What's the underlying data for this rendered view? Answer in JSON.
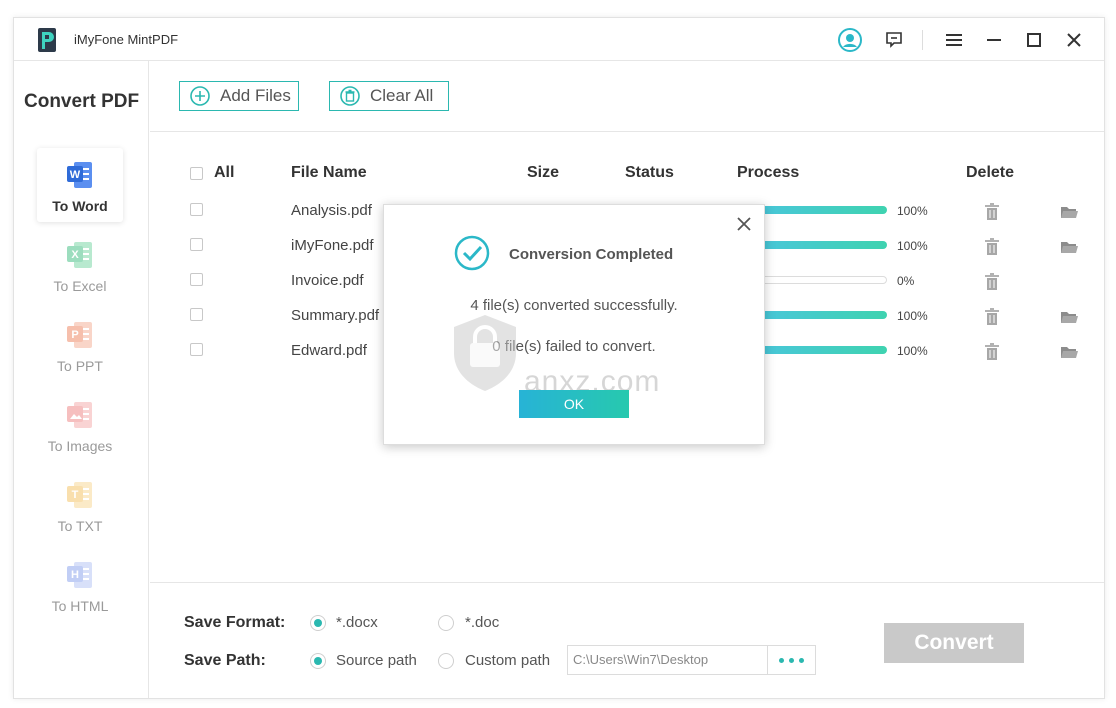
{
  "app": {
    "title": "iMyFone MintPDF"
  },
  "sidebar": {
    "title": "Convert PDF",
    "items": [
      {
        "label": "To Word",
        "letter": "W",
        "color": "#2f6bd8",
        "active": true
      },
      {
        "label": "To Excel",
        "letter": "X",
        "color": "#4cc38a",
        "active": false
      },
      {
        "label": "To PPT",
        "letter": "P",
        "color": "#ef8b6a",
        "active": false
      },
      {
        "label": "To Images",
        "letter": "img",
        "color": "#ef8b8b",
        "active": false
      },
      {
        "label": "To TXT",
        "letter": "T",
        "color": "#f5c66b",
        "active": false
      },
      {
        "label": "To HTML",
        "letter": "H",
        "color": "#8fa7ee",
        "active": false
      }
    ]
  },
  "toolbar": {
    "add_files": "Add Files",
    "clear_all": "Clear All"
  },
  "table": {
    "headers": {
      "all": "All",
      "file_name": "File Name",
      "size": "Size",
      "status": "Status",
      "process": "Process",
      "delete": "Delete"
    },
    "rows": [
      {
        "name": "Analysis.pdf",
        "progress": "100%",
        "done": true
      },
      {
        "name": "iMyFone.pdf",
        "progress": "100%",
        "done": true
      },
      {
        "name": "Invoice.pdf",
        "progress": "0%",
        "done": false
      },
      {
        "name": "Summary.pdf",
        "progress": "100%",
        "done": true
      },
      {
        "name": "Edward.pdf",
        "progress": "100%",
        "done": true
      }
    ]
  },
  "bottom": {
    "save_format_label": "Save Format:",
    "save_path_label": "Save Path:",
    "format_options": [
      "*.docx",
      "*.doc"
    ],
    "path_options": [
      "Source path",
      "Custom path"
    ],
    "path_value": "C:\\Users\\Win7\\Desktop",
    "convert_label": "Convert"
  },
  "modal": {
    "title": "Conversion Completed",
    "success_msg": "4 file(s) converted successfully.",
    "fail_msg": "0 file(s) failed to convert.",
    "ok_label": "OK"
  },
  "watermark": {
    "text": "anxz.com"
  },
  "colors": {
    "accent": "#2bb8b0",
    "progress_start": "#49c6db",
    "progress_end": "#3fd3b0"
  }
}
